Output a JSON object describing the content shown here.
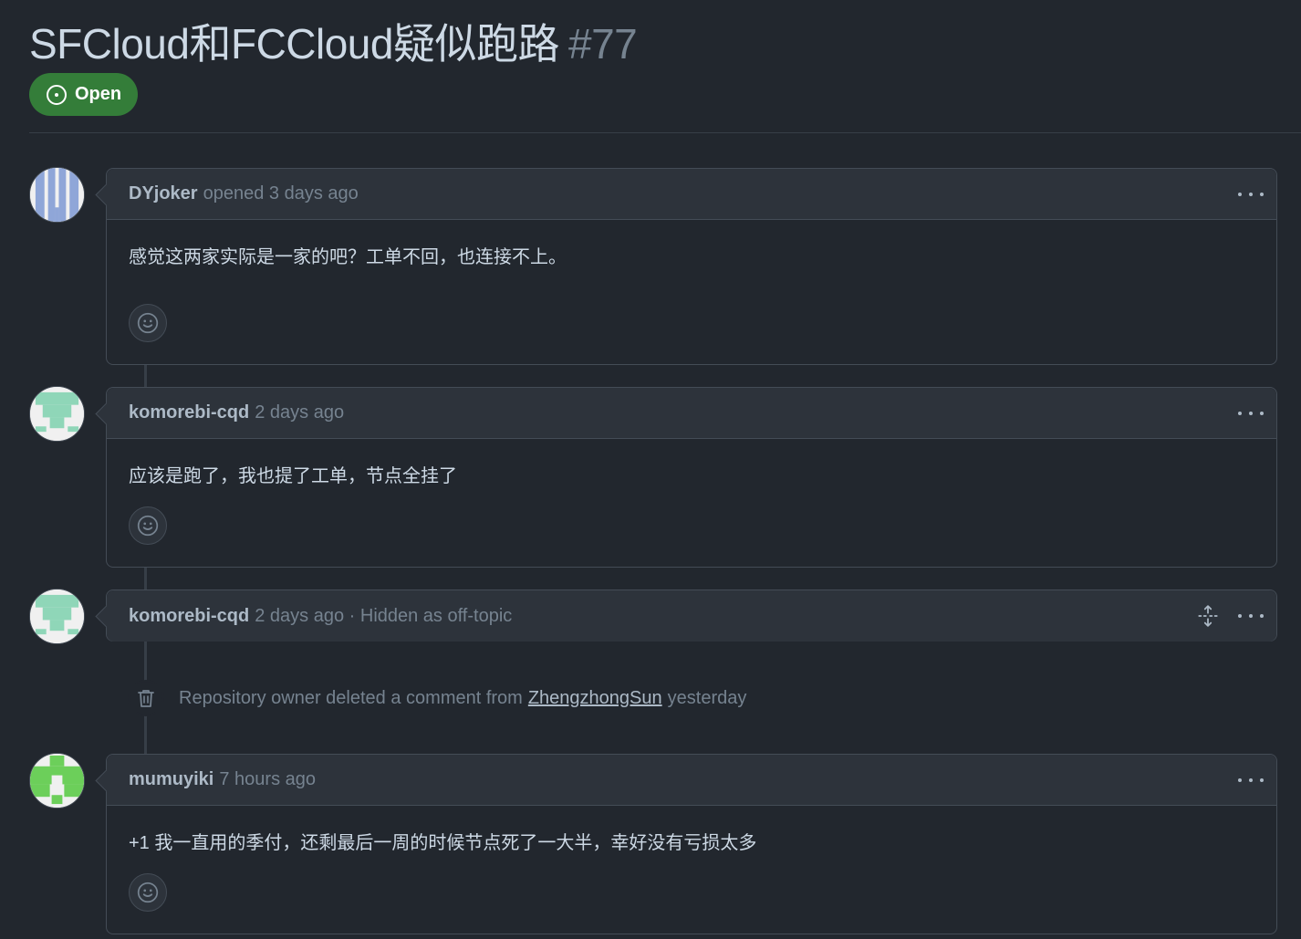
{
  "issue": {
    "title": "SFCloud和FCCloud疑似跑路",
    "number": "#77",
    "state": "Open",
    "state_color": "#347d39"
  },
  "comments": [
    {
      "author": "DYjoker",
      "meta": "opened 3 days ago",
      "body": "感觉这两家实际是一家的吧？工单不回，也连接不上。",
      "avatar_icon": "identicon-blue-stripes"
    },
    {
      "author": "komorebi-cqd",
      "meta": "2 days ago",
      "body": "应该是跑了，我也提了工单，节点全挂了",
      "avatar_icon": "identicon-mint"
    },
    {
      "author": "komorebi-cqd",
      "meta": "2 days ago · Hidden as off-topic",
      "avatar_icon": "identicon-mint"
    },
    {
      "author": "mumuyiki",
      "meta": "7 hours ago",
      "body": "+1 我一直用的季付，还剩最后一周的时候节点死了一大半，幸好没有亏损太多",
      "avatar_icon": "identicon-green"
    }
  ],
  "event": {
    "text_before": "Repository owner deleted a comment from",
    "user": "ZhengzhongSun",
    "text_after": "yesterday",
    "icon": "trash-icon"
  },
  "icons": {
    "state": "issue-opened-icon",
    "reaction": "smiley-icon",
    "menu": "kebab-horizontal-icon",
    "expand": "unfold-icon"
  }
}
